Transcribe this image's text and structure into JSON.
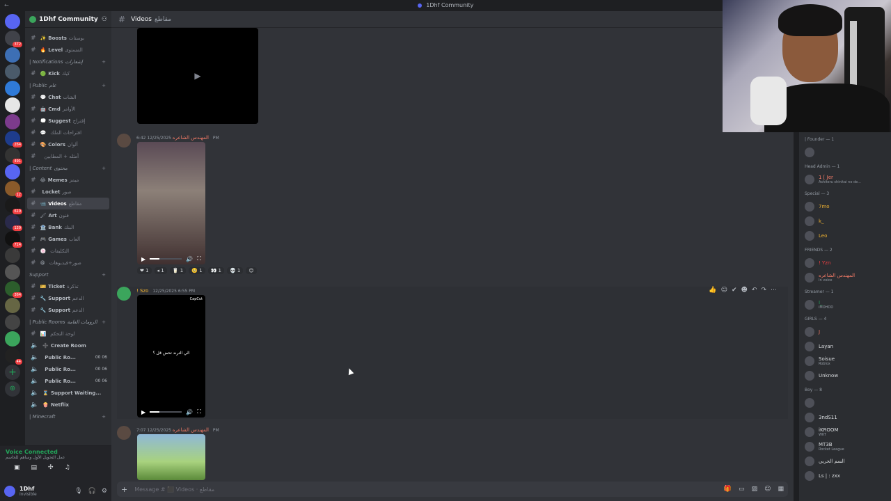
{
  "titlebar": {
    "title": "1Dhf Community"
  },
  "server_rail": {
    "badges": [
      "372",
      "264",
      "491",
      "12",
      "619",
      "129",
      "714",
      "364",
      "44"
    ]
  },
  "guild": {
    "name": "1Dhf Community"
  },
  "channels": [
    {
      "type": "text",
      "emoji": "✨",
      "name": "Boosts",
      "sub": "بوستات"
    },
    {
      "type": "text",
      "emoji": "🔥",
      "name": "Level",
      "sub": "المستوى"
    },
    {
      "type": "category",
      "name": "| Notifications",
      "sub": "إشعارات"
    },
    {
      "type": "text",
      "emoji": "🟢",
      "name": "Kick",
      "sub": "كيك"
    },
    {
      "type": "category",
      "name": "| Public",
      "sub": "عام"
    },
    {
      "type": "text",
      "emoji": "💬",
      "name": "Chat",
      "sub": "الشات"
    },
    {
      "type": "text",
      "emoji": "🤖",
      "name": "Cmd",
      "sub": "الأوامر"
    },
    {
      "type": "text",
      "emoji": "💭",
      "name": "Suggest",
      "sub": "إقتراح"
    },
    {
      "type": "text",
      "emoji": "💬",
      "name": "",
      "sub": "اقتراحات الملك"
    },
    {
      "type": "text",
      "emoji": "🎨",
      "name": "Colors",
      "sub": "ألوان"
    },
    {
      "type": "text",
      "emoji": "",
      "name": "",
      "sub": "أمثله + المطابين"
    },
    {
      "type": "category",
      "name": "| Content",
      "sub": "محتوى"
    },
    {
      "type": "text",
      "emoji": "😂",
      "name": "Memes",
      "sub": "ميمز"
    },
    {
      "type": "text",
      "emoji": "",
      "name": "Locket",
      "sub": "صور"
    },
    {
      "type": "text",
      "emoji": "📹",
      "name": "Videos",
      "sub": "مقاطع",
      "active": true
    },
    {
      "type": "text",
      "emoji": "🖌",
      "name": "Art",
      "sub": "فنون"
    },
    {
      "type": "text",
      "emoji": "🏦",
      "name": "Bank",
      "sub": "البنك"
    },
    {
      "type": "text",
      "emoji": "🎮",
      "name": "Games",
      "sub": "ألعاب"
    },
    {
      "type": "text",
      "emoji": "🍥",
      "name": "",
      "sub": "التكليفات"
    },
    {
      "type": "text",
      "emoji": "😁",
      "name": "",
      "sub": "صور+فيديوهات"
    },
    {
      "type": "category",
      "name": "Support",
      "sub": ""
    },
    {
      "type": "text",
      "emoji": "🎫",
      "name": "Ticket",
      "sub": "تذكرة"
    },
    {
      "type": "text",
      "emoji": "🔧",
      "name": "Support",
      "sub": "الدعم"
    },
    {
      "type": "text",
      "emoji": "🔧",
      "name": "Support",
      "sub": "الدعم"
    },
    {
      "type": "category",
      "name": "| Public Rooms",
      "sub": "الرومات العامة"
    },
    {
      "type": "text",
      "emoji": "📊",
      "name": "",
      "sub": "لوحة التحكم"
    },
    {
      "type": "voice",
      "emoji": "➕",
      "name": "Create Room",
      "sub": ""
    },
    {
      "type": "voice",
      "emoji": "",
      "name": "Public Ro...",
      "users": "00  06"
    },
    {
      "type": "voice",
      "emoji": "",
      "name": "Public Ro...",
      "users": "00  06"
    },
    {
      "type": "voice",
      "emoji": "",
      "name": "Public Ro...",
      "users": "00  06"
    },
    {
      "type": "voice",
      "emoji": "⌛",
      "name": "Support Waiting...",
      "sub": ""
    },
    {
      "type": "voice",
      "emoji": "🍿",
      "name": "Netflix",
      "sub": ""
    },
    {
      "type": "category",
      "name": "| Minecraft",
      "sub": ""
    }
  ],
  "voice_panel": {
    "status": "Voice Connected",
    "channel": "عمل التحويل الأول وساهم للحاسم"
  },
  "user_panel": {
    "name": "1Dhf",
    "status": "Invisible",
    "footer": "sho1uqli"
  },
  "chat_header": {
    "channel": "Videos",
    "sub": "مقاطع"
  },
  "messages": [
    {
      "author": "المهندس الشاعره",
      "time": "12/25/2025 6:42 PM",
      "reactions": [
        "❤ 1",
        "◂ 1",
        "🥛 1",
        "🥺 1",
        "👀 1",
        "💀 1",
        "☺"
      ]
    },
    {
      "author": "! Szo",
      "time": "12/25/2025 6:55 PM",
      "video_text": "الي الترند تحض قل ؟",
      "watermark": "CapCut"
    },
    {
      "author": "المهندس الشاعره",
      "time": "12/25/2025 7:07 PM"
    }
  ],
  "composer": {
    "placeholder": "Message # ⬛ Videos · مقاطع"
  },
  "members": [
    {
      "role": "| Founder — 1"
    },
    {
      "name": "",
      "status": "",
      "color": "#f23f43"
    },
    {
      "role": "Head Admin — 1"
    },
    {
      "name": "1 [ Jer",
      "status": "Ashiteru shinitai no de...",
      "color": "#f47b67"
    },
    {
      "role": "Special — 3"
    },
    {
      "name": "7mo",
      "status": "",
      "color": "#f0b232"
    },
    {
      "name": "k_",
      "status": "",
      "color": "#f0b232"
    },
    {
      "name": "Leo",
      "status": "",
      "color": "#f0b232"
    },
    {
      "role": "FRIENDS — 2"
    },
    {
      "name": "! Yzn",
      "status": "",
      "color": "#f23f43"
    },
    {
      "name": "المهندس الشاعره",
      "status": "In voice",
      "color": "#f47b67"
    },
    {
      "role": "Streamer — 1"
    },
    {
      "name": "I_",
      "status": "iMOHDD",
      "color": "#23a55a"
    },
    {
      "role": "GIRLS — 4"
    },
    {
      "name": "J",
      "status": "",
      "color": "#f47b67"
    },
    {
      "name": "Layan",
      "status": "",
      "color": "#dbdee1"
    },
    {
      "name": "Soisue",
      "status": "Roblox",
      "color": "#dbdee1"
    },
    {
      "name": "Unknow",
      "status": "",
      "color": "#dbdee1"
    },
    {
      "role": "Boy — 8"
    },
    {
      "name": "",
      "status": "",
      "color": "#f23f43"
    },
    {
      "name": "3ndS11",
      "status": "",
      "color": "#dbdee1"
    },
    {
      "name": "iKROOM",
      "status": "WKT",
      "color": "#dbdee1"
    },
    {
      "name": "MT3B",
      "status": "Rocket League",
      "color": "#dbdee1"
    },
    {
      "name": "السم الحربي",
      "status": "",
      "color": "#dbdee1"
    },
    {
      "name": "Ls | : zxx",
      "status": "",
      "color": "#dbdee1"
    }
  ]
}
